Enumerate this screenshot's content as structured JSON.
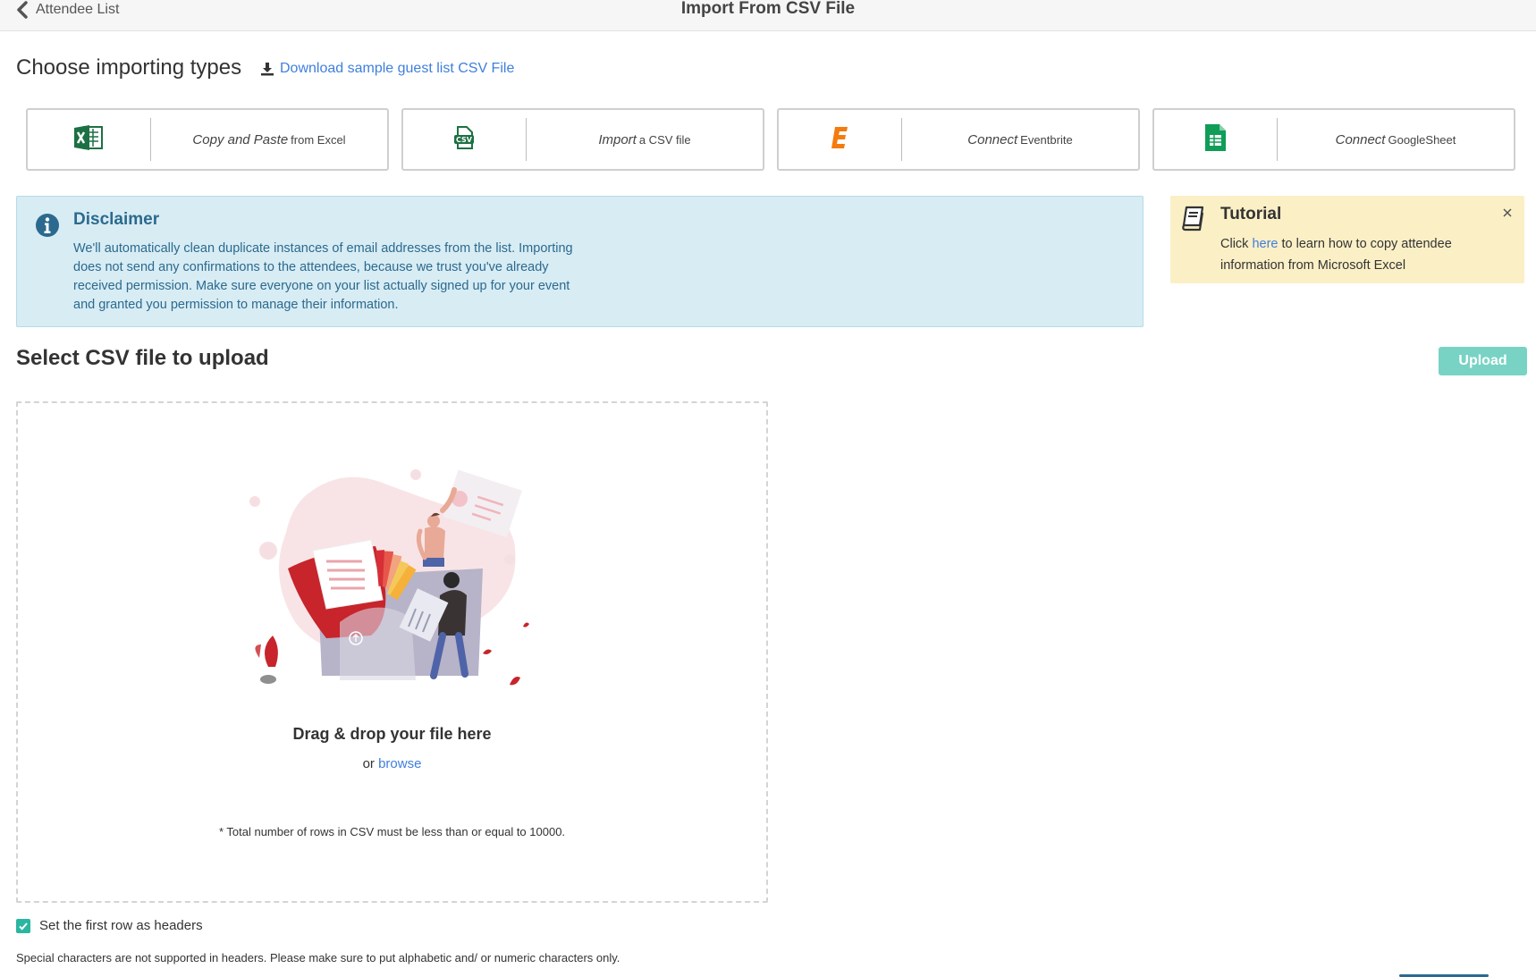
{
  "header": {
    "back_label": "Attendee List",
    "title": "Import From CSV File"
  },
  "import_types": {
    "title": "Choose importing types",
    "download_link": "Download sample guest list CSV File",
    "cards": [
      {
        "italic": "Copy and Paste",
        "rest": "from Excel",
        "icon": "excel-icon"
      },
      {
        "italic": "Import",
        "rest": "a CSV file",
        "icon": "csv-file-icon"
      },
      {
        "italic": "Connect",
        "rest": "Eventbrite",
        "icon": "eventbrite-icon"
      },
      {
        "italic": "Connect",
        "rest": "GoogleSheet",
        "icon": "google-sheets-icon"
      }
    ]
  },
  "disclaimer": {
    "title": "Disclaimer",
    "text": "We'll automatically clean duplicate instances of email addresses from the list. Importing does not send any confirmations to the attendees, because we trust you've already received permission. Make sure everyone on your list actually signed up for your event and granted you permission to manage their information."
  },
  "tutorial": {
    "title": "Tutorial",
    "text_before": "Click ",
    "link": "here",
    "text_after": " to learn how to copy attendee information from Microsoft Excel"
  },
  "upload_section": {
    "title": "Select CSV file to upload",
    "upload_button": "Upload",
    "drop_title": "Drag & drop your file here",
    "or_text": "or ",
    "browse_link": "browse",
    "row_limit_note": "* Total number of rows in CSV must be less than or equal to 10000.",
    "header_checkbox_label": "Set the first row as headers",
    "header_checkbox_checked": true,
    "special_chars_note": "Special characters are not supported in headers. Please make sure to put alphabetic and/ or numeric characters only."
  },
  "colors": {
    "accent": "#3f7fdc",
    "upload_button": "#79d3c4",
    "checkbox": "#2bb6a1",
    "disclaimer_bg": "#d8ecf4",
    "tutorial_bg": "#fbefc6"
  }
}
